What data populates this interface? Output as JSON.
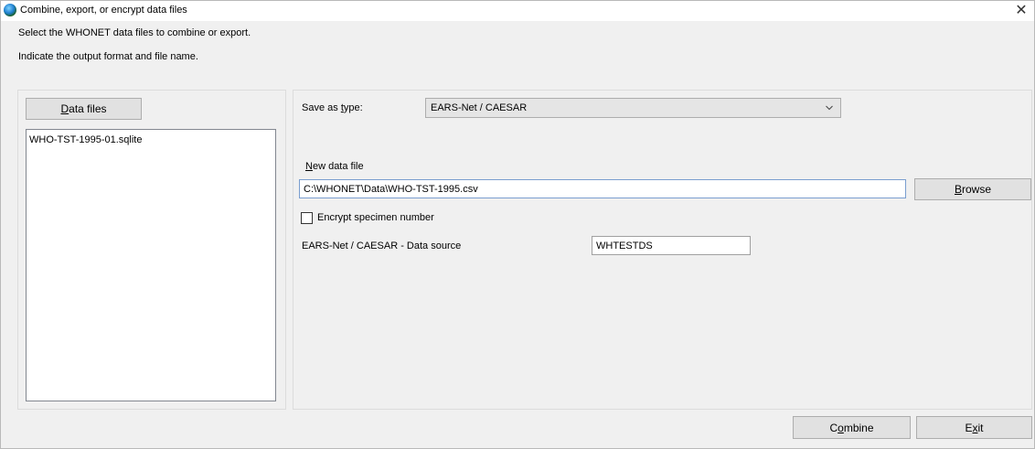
{
  "window": {
    "title": "Combine, export, or encrypt data files",
    "close_glyph": "✕"
  },
  "instructions": {
    "line1": "Select the WHONET data files to combine or export.",
    "line2": "Indicate the output format and file name."
  },
  "left": {
    "data_files_button": {
      "accel": "D",
      "rest": "ata files"
    },
    "files": [
      "WHO-TST-1995-01.sqlite"
    ]
  },
  "right": {
    "save_as_label": {
      "pre": "Save as ",
      "accel": "t",
      "post": "ype:"
    },
    "save_as_value": "EARS-Net / CAESAR",
    "new_file_label": {
      "accel": "N",
      "rest": "ew data file"
    },
    "new_file_value": "C:\\WHONET\\Data\\WHO-TST-1995.csv",
    "browse_button": {
      "accel": "B",
      "rest": "rowse"
    },
    "encrypt_label": "Encrypt specimen number",
    "encrypt_checked": false,
    "data_source_label": "EARS-Net / CAESAR - Data source",
    "data_source_value": "WHTESTDS"
  },
  "footer": {
    "combine_button": {
      "pre": "C",
      "accel": "o",
      "post": "mbine"
    },
    "exit_button": {
      "pre": "E",
      "accel": "x",
      "post": "it"
    }
  },
  "icons": {
    "app": "globe-icon",
    "close": "close-icon",
    "dropdown": "chevron-down-icon"
  }
}
